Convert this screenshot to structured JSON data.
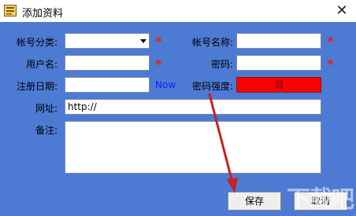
{
  "window": {
    "title": "添加资料",
    "close_glyph": "✕"
  },
  "form": {
    "account_category_label": "帐号分类:",
    "account_category_value": "",
    "account_name_label": "帐号名称:",
    "account_name_value": "",
    "username_label": "用户名:",
    "username_value": "",
    "password_label": "密码:",
    "password_value": "",
    "reg_date_label": "注册日期:",
    "reg_date_value": "",
    "now_link": "Now",
    "strength_label": "密码强度:",
    "strength_value": "弱",
    "url_label": "网址:",
    "url_value": "http://",
    "notes_label": "备注:",
    "notes_value": "",
    "required_mark": "*"
  },
  "buttons": {
    "save": "保存",
    "cancel": "取消"
  },
  "colors": {
    "client_bg": "#4d7ad2",
    "strength_weak": "#ff0000",
    "required": "#e02020",
    "now_link": "#1a1aff",
    "annotation_arrow": "#cc1f1f"
  },
  "watermark": "下载吧"
}
